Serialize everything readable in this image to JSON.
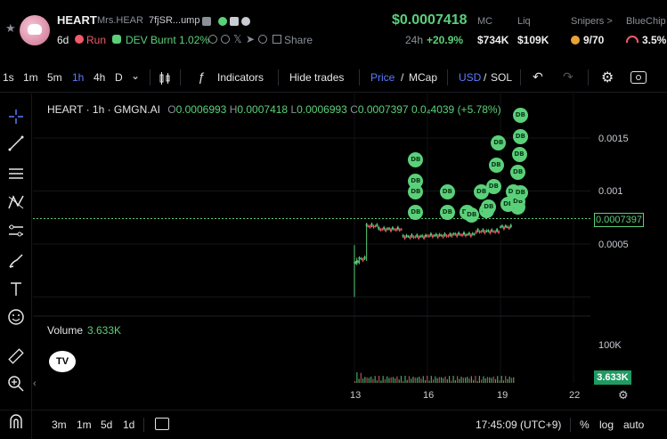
{
  "token": {
    "name": "HEART",
    "sub": "Mrs.HEAR",
    "ca": "7fjSR...ump",
    "age": "6d",
    "run_label": "Run",
    "dev_burnt": "DEV Burnt 1.02%",
    "share_label": "Share"
  },
  "stats": {
    "price": "$0.0007418",
    "change_label": "24h",
    "change_value": "+20.9%",
    "mc_label": "MC",
    "mc_value": "$734K",
    "liq_label": "Liq",
    "liq_value": "$109K",
    "snipers_label": "Snipers >",
    "snipers_value": "9/70",
    "bluechip_label": "BlueChip",
    "bluechip_value": "3.5%"
  },
  "toolbar": {
    "intervals": [
      "1s",
      "1m",
      "5m",
      "1h",
      "4h",
      "D"
    ],
    "active_interval": "1h",
    "indicators_label": "Indicators",
    "hide_trades_label": "Hide trades",
    "price_label": "Price",
    "mcap_label": "MCap",
    "usd_label": "USD",
    "sol_label": "SOL",
    "slash": "/"
  },
  "legend": {
    "title": "HEART · 1h · GMGN.AI",
    "o_label": "O",
    "o_value": "0.0006993",
    "h_label": "H",
    "h_value": "0.0007418",
    "l_label": "L",
    "l_value": "0.0006993",
    "c_label": "C",
    "c_value": "0.0007397",
    "change": "0.0₄4039 (+5.78%)"
  },
  "chart_data": {
    "type": "candlestick",
    "interval": "1h",
    "x_ticks": [
      "13",
      "16",
      "19",
      "22"
    ],
    "y_ticks": [
      "0.0015",
      "0.001",
      "0.0005"
    ],
    "last_price_label": "0.0007397",
    "volume_label": "Volume",
    "volume_value": "3.633K",
    "volume_tick": "100K",
    "volume_last_label": "3.633K",
    "trade_marker_label": "DB",
    "ohlc": [
      {
        "x": 13.0,
        "o": 0.0,
        "h": 0.00049,
        "l": 0.0,
        "c": 0.00032
      },
      {
        "x": 13.1,
        "o": 0.00032,
        "h": 0.00037,
        "l": 0.0003,
        "c": 0.00033
      },
      {
        "x": 13.2,
        "o": 0.00033,
        "h": 0.00037,
        "l": 0.00031,
        "c": 0.00036
      },
      {
        "x": 13.5,
        "o": 0.00036,
        "h": 0.0007,
        "l": 0.00034,
        "c": 0.00067
      },
      {
        "x": 14.0,
        "o": 0.00067,
        "h": 0.00069,
        "l": 0.00061,
        "c": 0.00064
      },
      {
        "x": 15.0,
        "o": 0.00064,
        "h": 0.00076,
        "l": 0.00055,
        "c": 0.00057
      },
      {
        "x": 16.0,
        "o": 0.00057,
        "h": 0.00062,
        "l": 0.00054,
        "c": 0.00058
      },
      {
        "x": 17.0,
        "o": 0.00058,
        "h": 0.00062,
        "l": 0.00055,
        "c": 0.00059
      },
      {
        "x": 18.0,
        "o": 0.00059,
        "h": 0.00063,
        "l": 0.00056,
        "c": 0.00062
      },
      {
        "x": 19.0,
        "o": 0.00062,
        "h": 0.00068,
        "l": 0.0006,
        "c": 0.00066
      },
      {
        "x": 19.5,
        "o": 0.00066,
        "h": 0.00074,
        "l": 0.00065,
        "c": 0.00074
      }
    ]
  },
  "bottom": {
    "ranges": [
      "3m",
      "1m",
      "5d",
      "1d"
    ],
    "clock": "17:45:09 (UTC+9)",
    "percent_label": "%",
    "log_label": "log",
    "auto_label": "auto"
  },
  "colors": {
    "up": "#5bd07a",
    "down": "#f05a6a",
    "accent": "#5b7cff",
    "bg": "#000000"
  }
}
